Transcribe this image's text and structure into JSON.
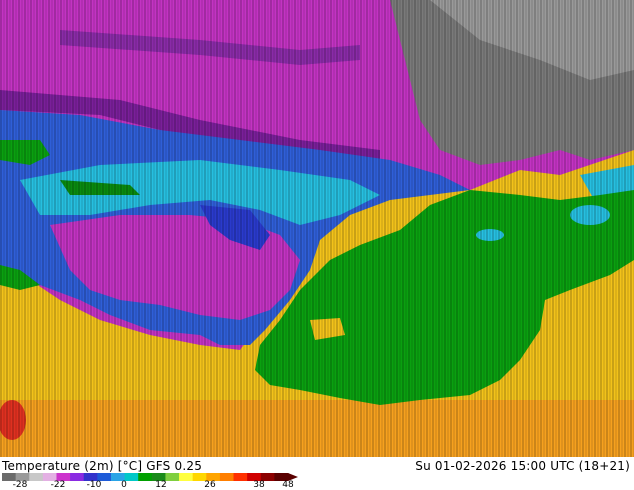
{
  "header": {
    "title": "Temperature (2m) [°C] GFS 0.25",
    "valid_time": "Su 01-02-2026 15:00 UTC (18+21)"
  },
  "legend": {
    "ticks": [
      "-28",
      "-22",
      "-10",
      "0",
      "12",
      "26",
      "38",
      "48"
    ],
    "colors": [
      "#6b6b6b",
      "#9a9a9a",
      "#c8c8c8",
      "#e3b0e3",
      "#cc33cc",
      "#8a2be2",
      "#3333cc",
      "#1e5bd8",
      "#29a4e6",
      "#00c8c8",
      "#00a000",
      "#1a8a1a",
      "#7fcf3f",
      "#ffff40",
      "#ffd700",
      "#ffa500",
      "#ff7f00",
      "#ff3000",
      "#d00000",
      "#8b0000",
      "#5a0000"
    ]
  },
  "map_colors": {
    "gray": "#6f6f6f",
    "light_gray": "#a8a8a8",
    "magenta": "#c633c6",
    "purple": "#7a1f9a",
    "dark_blue": "#2b2bcc",
    "blue": "#2a66e0",
    "cyan": "#23c4e0",
    "green": "#0aa010",
    "dark_green": "#0a7a10",
    "yellow": "#f5e000",
    "orange": "#f7a020",
    "red": "#e03020"
  }
}
